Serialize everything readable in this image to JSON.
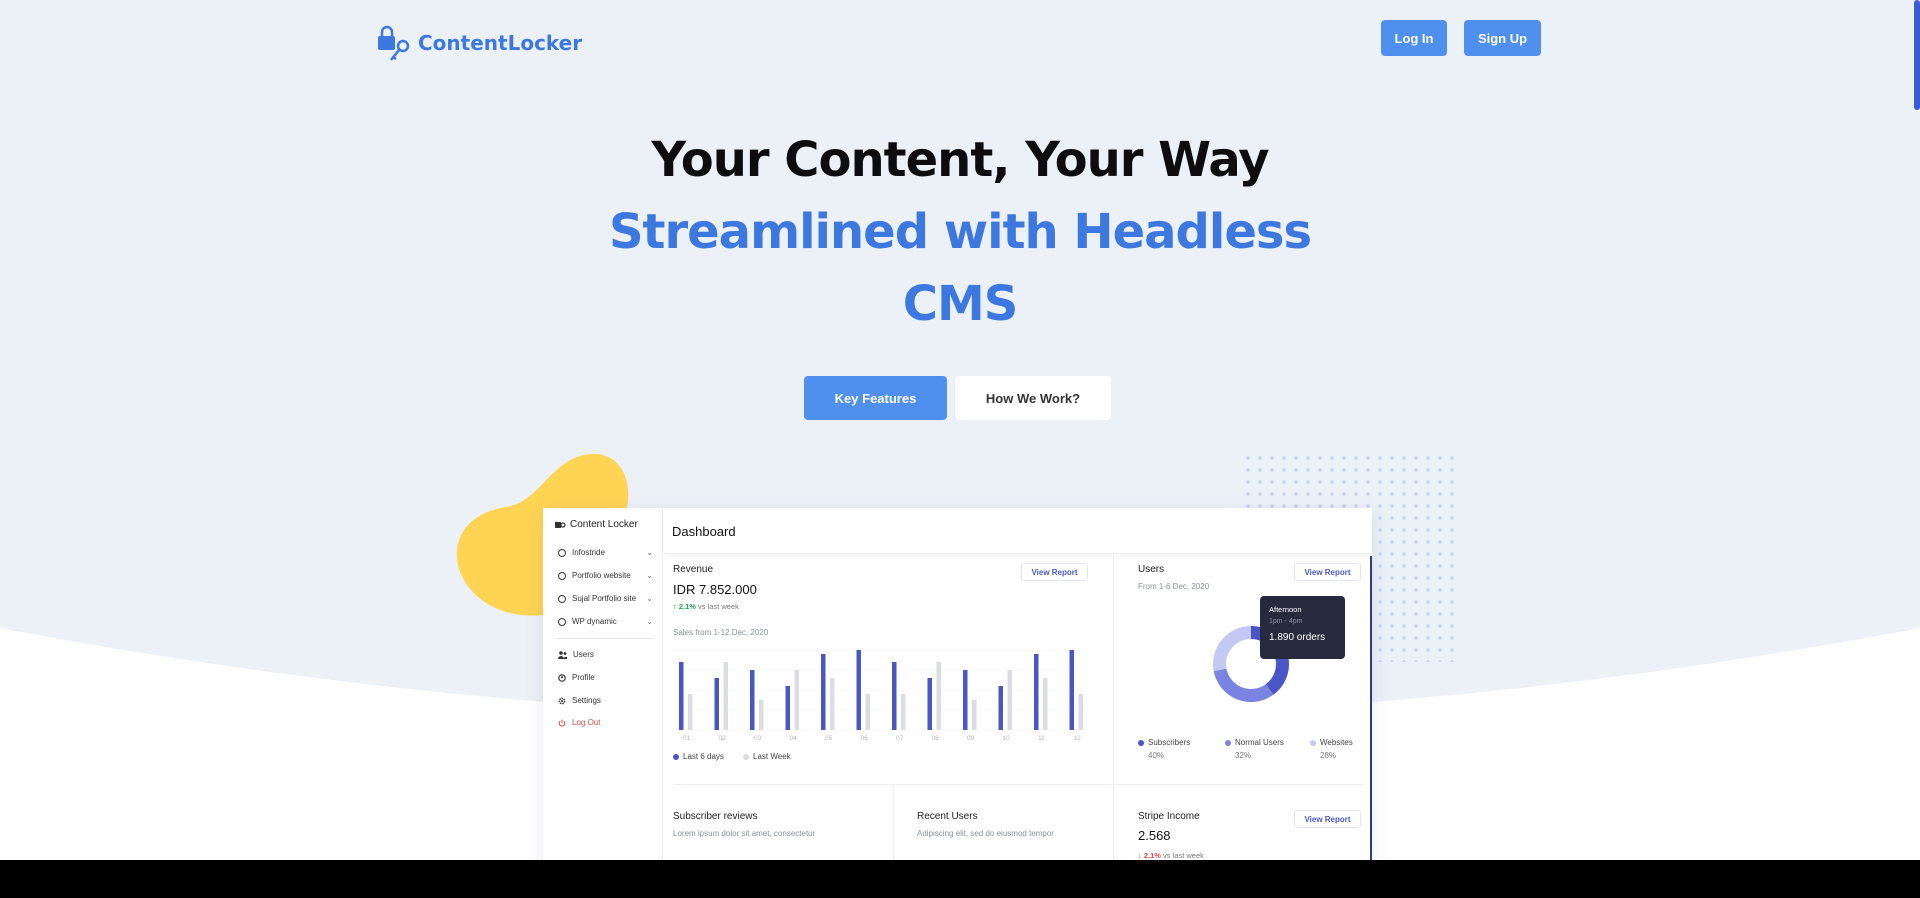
{
  "header": {
    "brand": "ContentLocker",
    "login_label": "Log In",
    "signup_label": "Sign Up"
  },
  "hero": {
    "line1": "Your Content, Your Way",
    "line2": "Streamlined with Headless",
    "line3": "CMS",
    "cta_primary": "Key Features",
    "cta_secondary": "How We Work?"
  },
  "colors": {
    "accent": "#3c78e0",
    "button": "#4f90ee",
    "blob": "#ffd454",
    "chart_primary": "#4a55c8",
    "chart_secondary": "#dcdde2"
  },
  "dashboard": {
    "brand": "Content Locker",
    "title": "Dashboard",
    "sidebar": {
      "sites": [
        "Infostride",
        "Portfolio website",
        "Sujal Portfolio site",
        "WP dynamic"
      ],
      "users": "Users",
      "profile": "Profile",
      "settings": "Settings",
      "logout": "Log Out"
    },
    "revenue": {
      "title": "Revenue",
      "view_report": "View Report",
      "amount": "IDR 7.852.000",
      "delta": "2.1%",
      "delta_text": "vs last week",
      "subtitle": "Sales from 1-12 Dec, 2020",
      "legend_current": "Last 6 days",
      "legend_previous": "Last Week"
    },
    "users": {
      "title": "Users",
      "view_report": "View Report",
      "subtitle": "From 1-6 Dec, 2020",
      "tooltip_title": "Afternoon",
      "tooltip_time": "1pm - 4pm",
      "tooltip_value": "1.890 orders",
      "legend": [
        {
          "label": "Subscribers",
          "value": "40%"
        },
        {
          "label": "Normal Users",
          "value": "32%"
        },
        {
          "label": "Websites",
          "value": "28%"
        }
      ]
    },
    "reviews": {
      "title": "Subscriber reviews",
      "subtitle": "Lorem ipsum dolor sit amet, consectetur"
    },
    "recent": {
      "title": "Recent Users",
      "subtitle": "Adipiscing elit, sed do eiusmod tempor"
    },
    "stripe": {
      "title": "Stripe Income",
      "view_report": "View Report",
      "amount": "2.568",
      "delta": "2.1%",
      "delta_text": "vs last week"
    }
  },
  "chart_data": [
    {
      "type": "bar",
      "title": "Sales from 1-12 Dec, 2020",
      "categories": [
        "01",
        "02",
        "03",
        "04",
        "05",
        "06",
        "07",
        "08",
        "09",
        "10",
        "11",
        "12"
      ],
      "series": [
        {
          "name": "Last 6 days",
          "values": [
            85,
            65,
            75,
            55,
            95,
            100,
            85,
            65,
            75,
            55,
            95,
            100
          ]
        },
        {
          "name": "Last Week",
          "values": [
            45,
            85,
            38,
            75,
            65,
            45,
            45,
            85,
            38,
            75,
            65,
            45
          ]
        }
      ],
      "ylim": [
        0,
        100
      ]
    },
    {
      "type": "pie",
      "labels": [
        "Subscribers",
        "Normal Users",
        "Websites"
      ],
      "values": [
        40,
        32,
        28
      ]
    }
  ]
}
